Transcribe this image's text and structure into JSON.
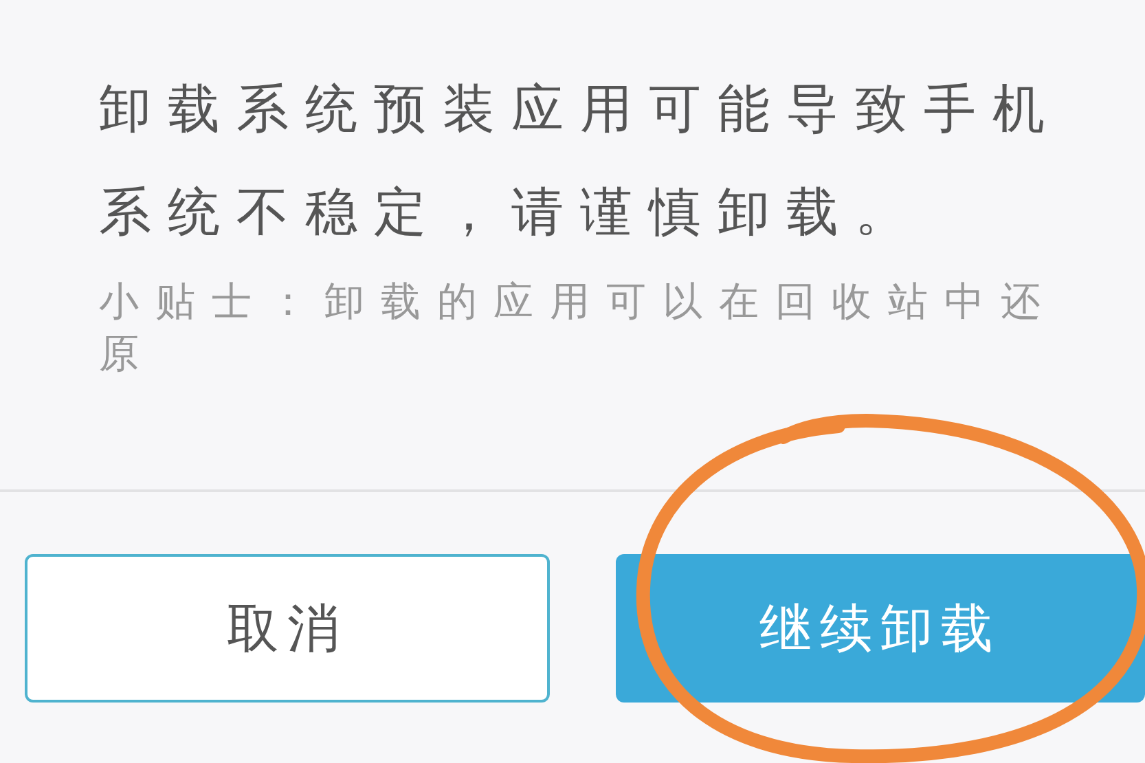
{
  "dialog": {
    "message": "卸载系统预装应用可能导致手机系统不稳定，请谨慎卸载。",
    "tip": "小贴士：卸载的应用可以在回收站中还原"
  },
  "buttons": [
    {
      "label": "取消",
      "kind": "secondary"
    },
    {
      "label": "继续卸载",
      "kind": "primary"
    }
  ]
}
